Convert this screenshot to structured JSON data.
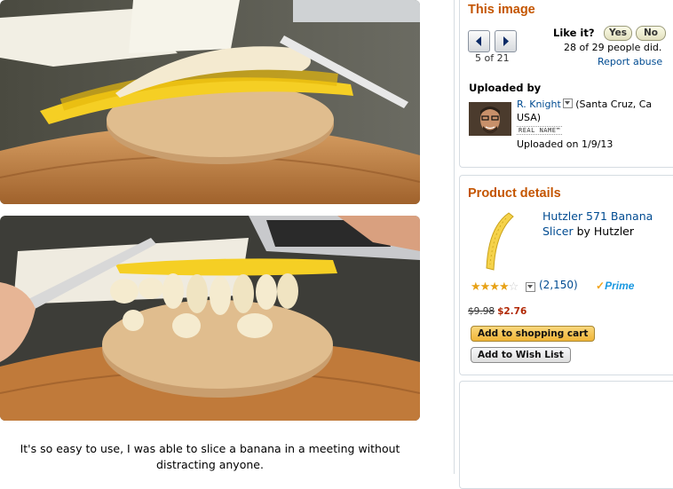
{
  "caption": "It's so easy to use, I was able to slice a banana in a meeting without distracting anyone.",
  "image_panel": {
    "title": "This image",
    "prev_icon": "left-arrow-icon",
    "next_icon": "right-arrow-icon",
    "counter": "5 of 21",
    "like_label": "Like it?",
    "yes_label": "Yes",
    "no_label": "No",
    "votes": "28 of 29 people did.",
    "report": "Report abuse",
    "uploaded_by_label": "Uploaded by",
    "uploader_name": "R. Knight",
    "uploader_location": "(Santa Cruz, Ca USA)",
    "real_name_badge": "REAL NAME™",
    "uploaded_on": "Uploaded on 1/9/13"
  },
  "product_panel": {
    "title": "Product details",
    "product_name": "Hutzler 571 Banana Slicer",
    "by_label": "by",
    "brand": "Hutzler",
    "rating": 3.5,
    "reviews": "(2,150)",
    "prime_label": "Prime",
    "list_price": "$9.98",
    "sale_price": "$2.76",
    "cart_button": "Add to shopping cart",
    "wish_button": "Add to Wish List"
  },
  "colors": {
    "heading": "#c45500",
    "link": "#004b91",
    "price": "#b12704",
    "cart_button": "#f0c14b"
  }
}
